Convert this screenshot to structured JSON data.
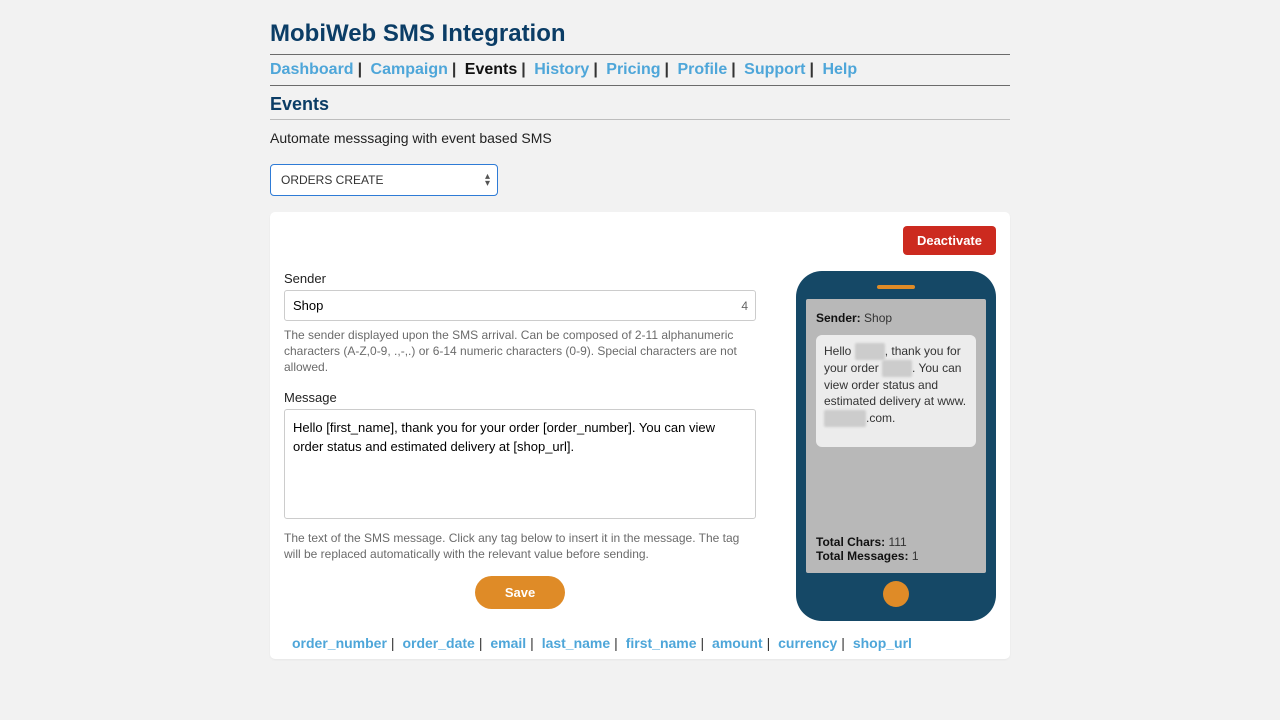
{
  "header": {
    "title": "MobiWeb SMS Integration"
  },
  "nav": {
    "items": [
      "Dashboard",
      "Campaign",
      "Events",
      "History",
      "Pricing",
      "Profile",
      "Support",
      "Help"
    ],
    "active_index": 2
  },
  "section": {
    "title": "Events",
    "subtitle": "Automate messsaging with event based SMS"
  },
  "event_select": {
    "value": "ORDERS CREATE"
  },
  "actions": {
    "deactivate": "Deactivate",
    "save": "Save"
  },
  "sender": {
    "label": "Sender",
    "value": "Shop",
    "char_count": "4",
    "help": "The sender displayed upon the SMS arrival. Can be composed of 2-11 alphanumeric characters (A-Z,0-9, .,-,.) or 6-14 numeric characters (0-9). Special characters are not allowed."
  },
  "message": {
    "label": "Message",
    "value": "Hello [first_name], thank you for your order [order_number]. You can view order status and estimated delivery at [shop_url].",
    "help": "The text of the SMS message. Click any tag below to insert it in the message. The tag will be replaced automatically with the relevant value before sending."
  },
  "preview": {
    "sender_label": "Sender:",
    "sender_value": "Shop",
    "line1a": "Hello ",
    "blur1": "xxxxx",
    "line1b": ", thank you for your order ",
    "blur2": "xxxxx",
    "line1c": ". You can view order status and estimated delivery at www.",
    "blur3": "xxxxxxx",
    "line1d": ".com.",
    "total_chars_label": "Total Chars:",
    "total_chars": "111",
    "total_msgs_label": "Total Messages:",
    "total_msgs": "1"
  },
  "tags": [
    "order_number",
    "order_date",
    "email",
    "last_name",
    "first_name",
    "amount",
    "currency",
    "shop_url"
  ]
}
